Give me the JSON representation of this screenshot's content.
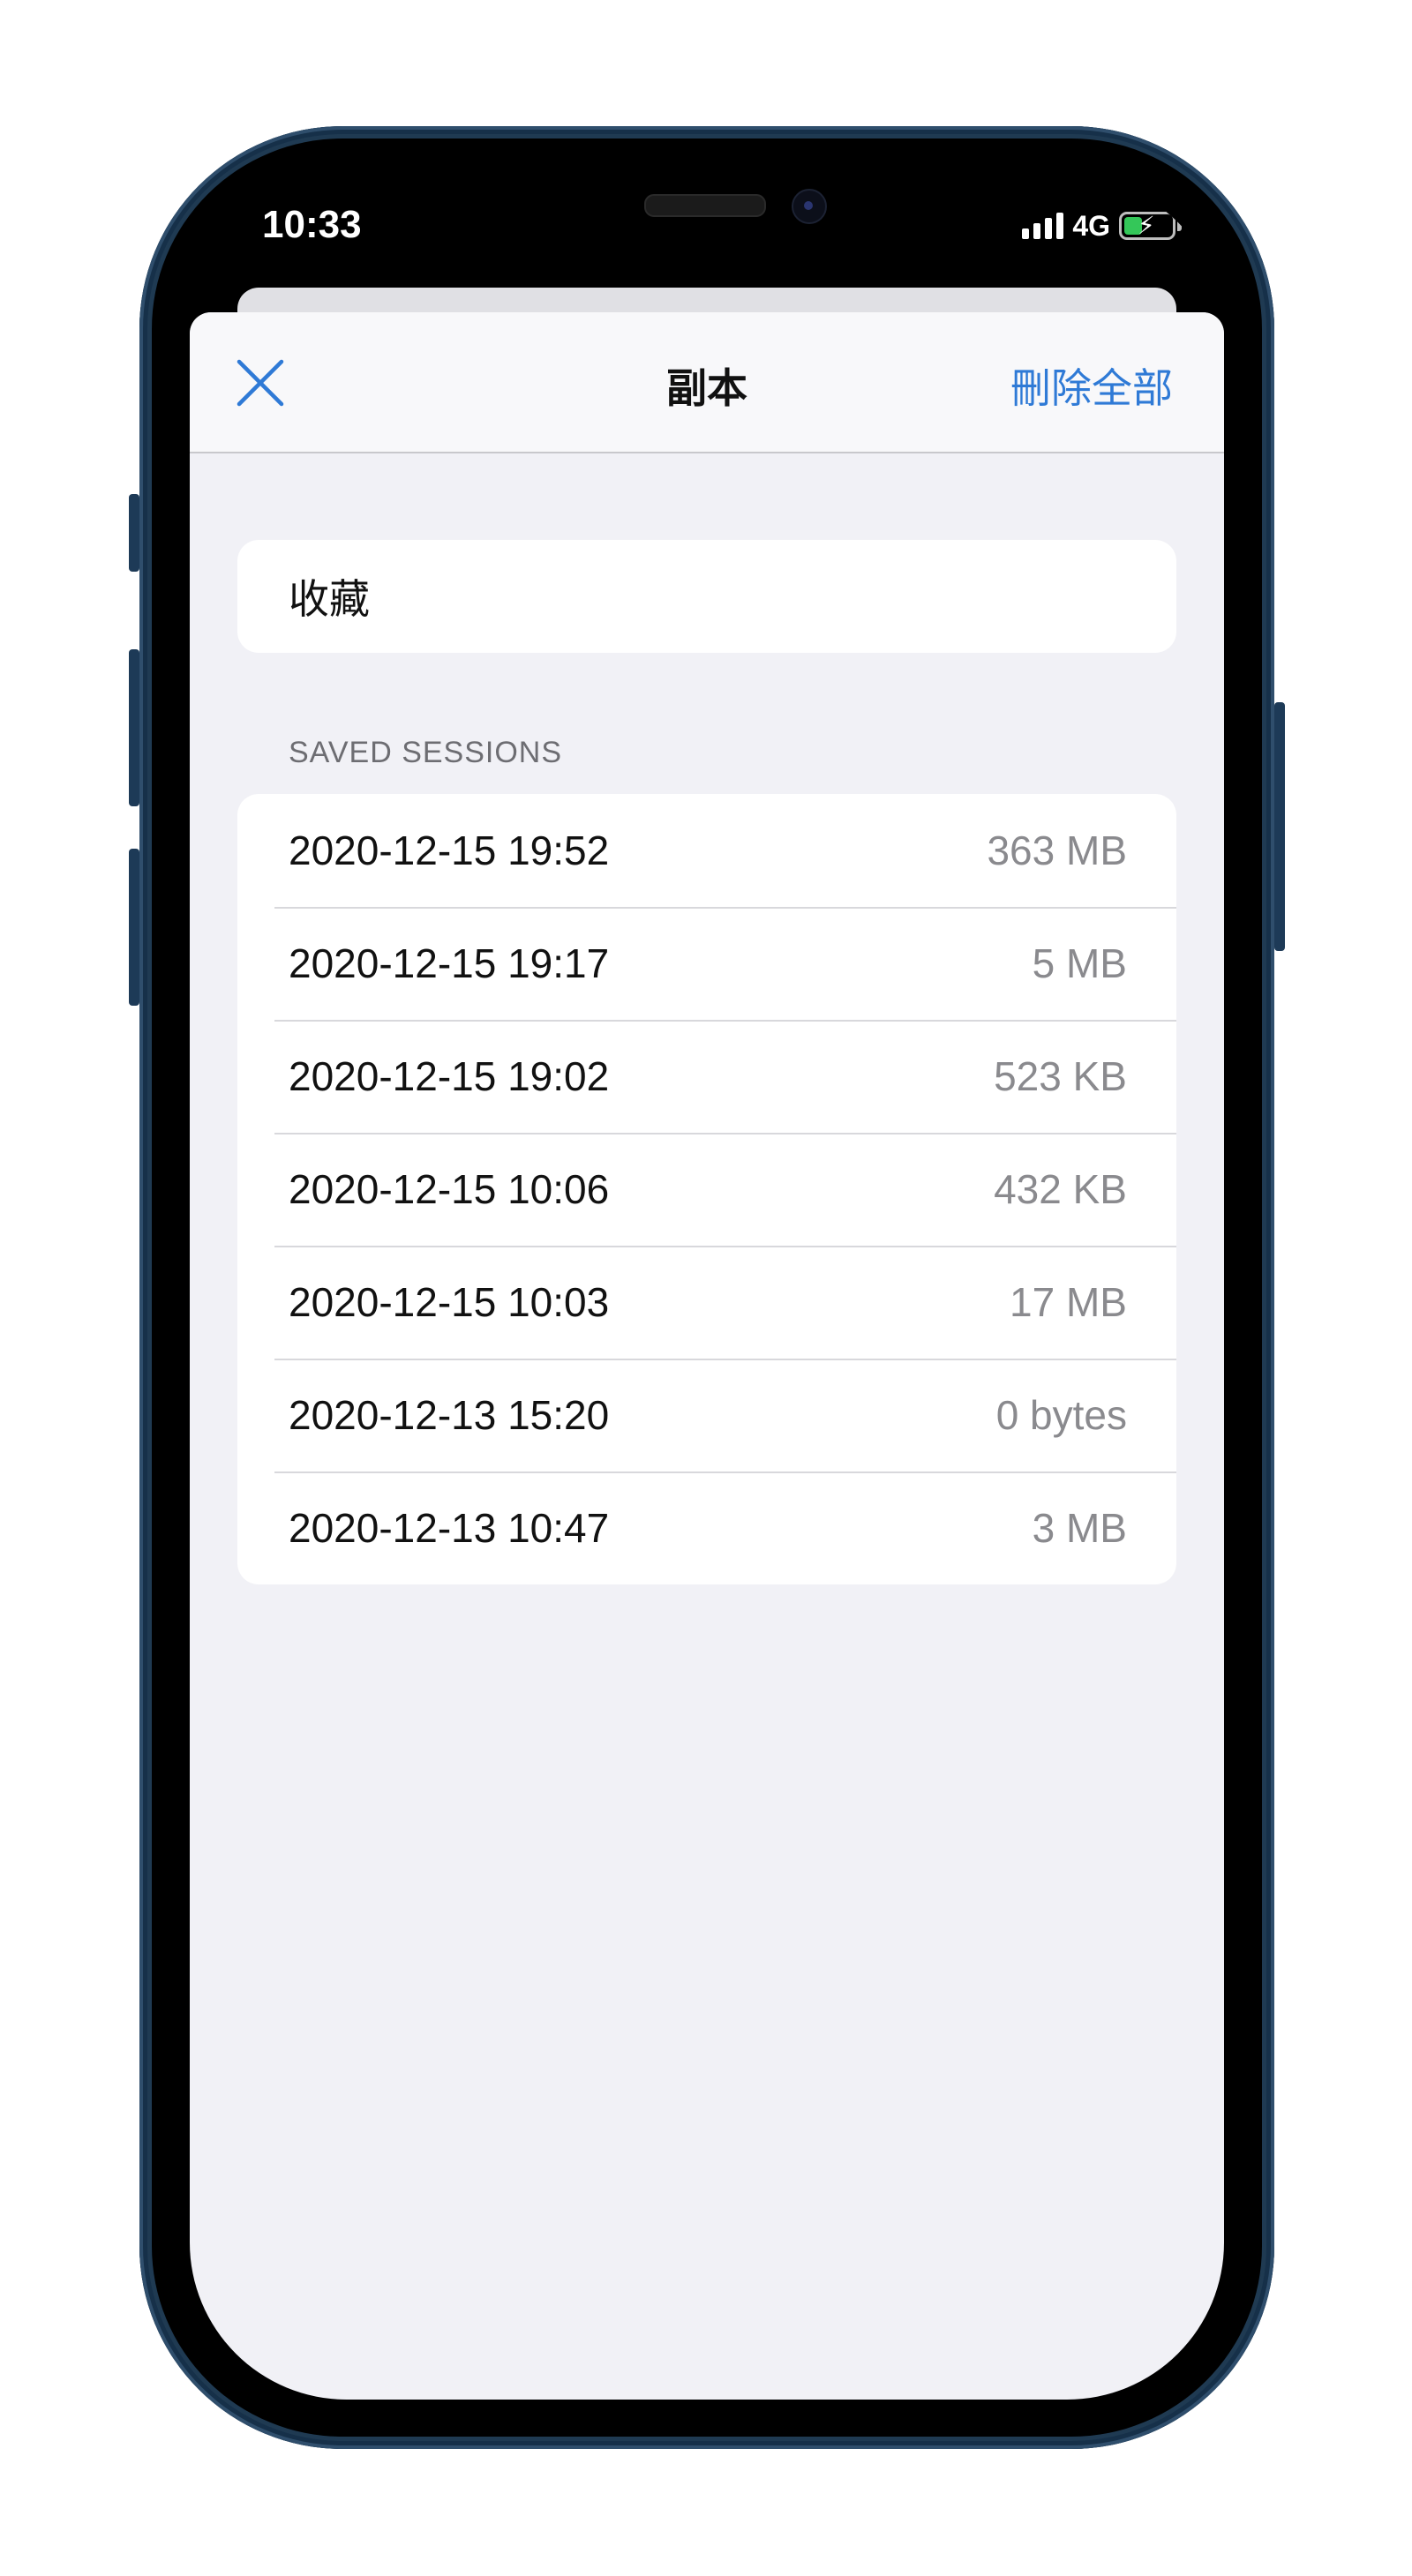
{
  "status_bar": {
    "time": "10:33",
    "network": "4G"
  },
  "navbar": {
    "title": "副本",
    "close_icon": "close-icon",
    "delete_all_label": "刪除全部"
  },
  "favorites": {
    "label": "收藏"
  },
  "saved_sessions": {
    "header": "SAVED SESSIONS",
    "items": [
      {
        "date": "2020-12-15 19:52",
        "size": "363 MB"
      },
      {
        "date": "2020-12-15 19:17",
        "size": "5 MB"
      },
      {
        "date": "2020-12-15 19:02",
        "size": "523 KB"
      },
      {
        "date": "2020-12-15 10:06",
        "size": "432 KB"
      },
      {
        "date": "2020-12-15 10:03",
        "size": "17 MB"
      },
      {
        "date": "2020-12-13 15:20",
        "size": "0 bytes"
      },
      {
        "date": "2020-12-13 10:47",
        "size": "3 MB"
      }
    ]
  },
  "colors": {
    "accent": "#2f7ad6",
    "sheet_background": "#f1f1f6",
    "secondary_text": "#8a8a8e",
    "battery_fill": "#34c759"
  }
}
